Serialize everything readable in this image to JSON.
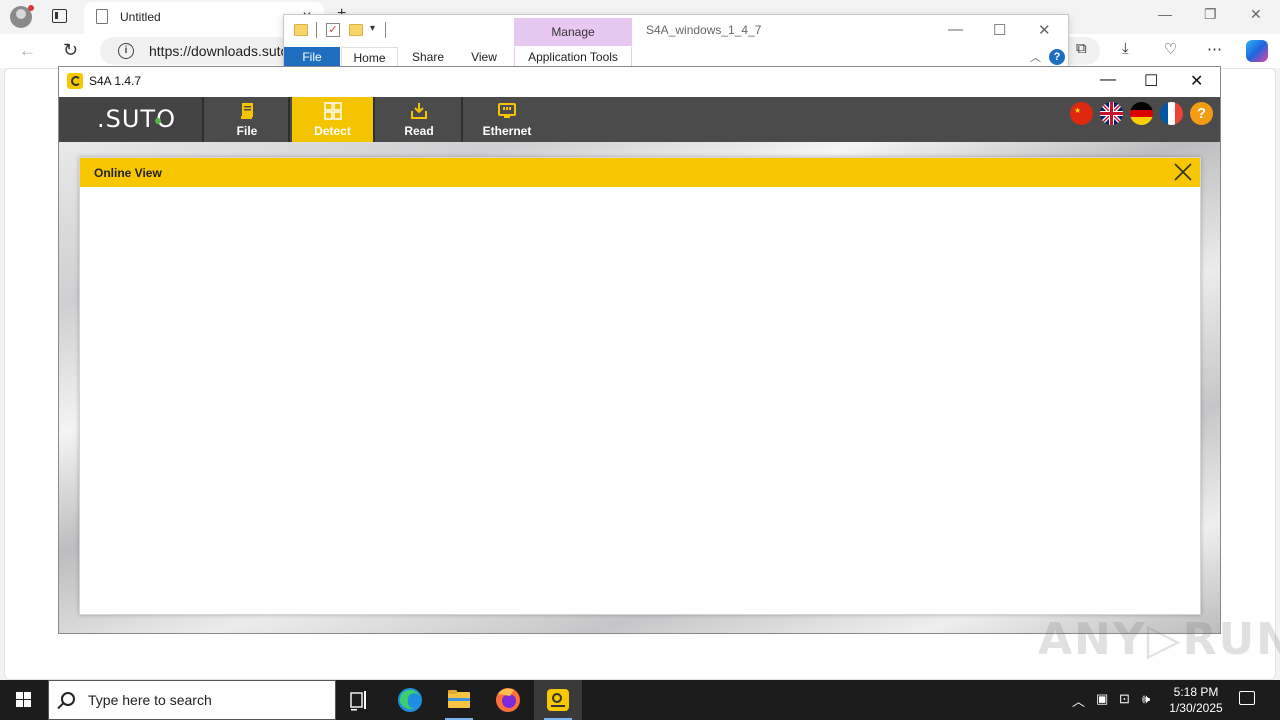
{
  "edge": {
    "tab_title": "Untitled",
    "url": "https://downloads.suto",
    "tab_close_glyph": "✕",
    "new_tab_glyph": "+"
  },
  "explorer": {
    "title": "S4A_windows_1_4_7",
    "manage_label": "Manage",
    "tabs": [
      "File",
      "Home",
      "Share",
      "View",
      "Application Tools"
    ],
    "help_glyph": "?"
  },
  "s4a": {
    "window_title": "S4A  1.4.7",
    "logo_text": ".SUTO",
    "toolbar": [
      {
        "label": "File",
        "icon": "file-icon",
        "active": false
      },
      {
        "label": "Detect",
        "icon": "detect-icon",
        "active": true
      },
      {
        "label": "Read",
        "icon": "read-icon",
        "active": false
      },
      {
        "label": "Ethernet",
        "icon": "ethernet-icon",
        "active": false
      }
    ],
    "languages": [
      "chinese-flag-icon",
      "uk-flag-icon",
      "german-flag-icon",
      "french-flag-icon"
    ],
    "help_glyph": "?",
    "online_view": {
      "title": "Online View"
    }
  },
  "watermark": "ANY▷RUN",
  "taskbar": {
    "search_placeholder": "Type here to search",
    "time": "5:18 PM",
    "date": "1/30/2025",
    "pinned": [
      "task-view-icon",
      "edge-icon",
      "file-explorer-icon",
      "firefox-icon",
      "s4a-icon"
    ]
  },
  "colors": {
    "accent_yellow": "#f5c400",
    "toolbar_gray": "#4b4b4b",
    "explorer_file_blue": "#1e6fbf",
    "manage_purple": "#e7c8f0"
  }
}
